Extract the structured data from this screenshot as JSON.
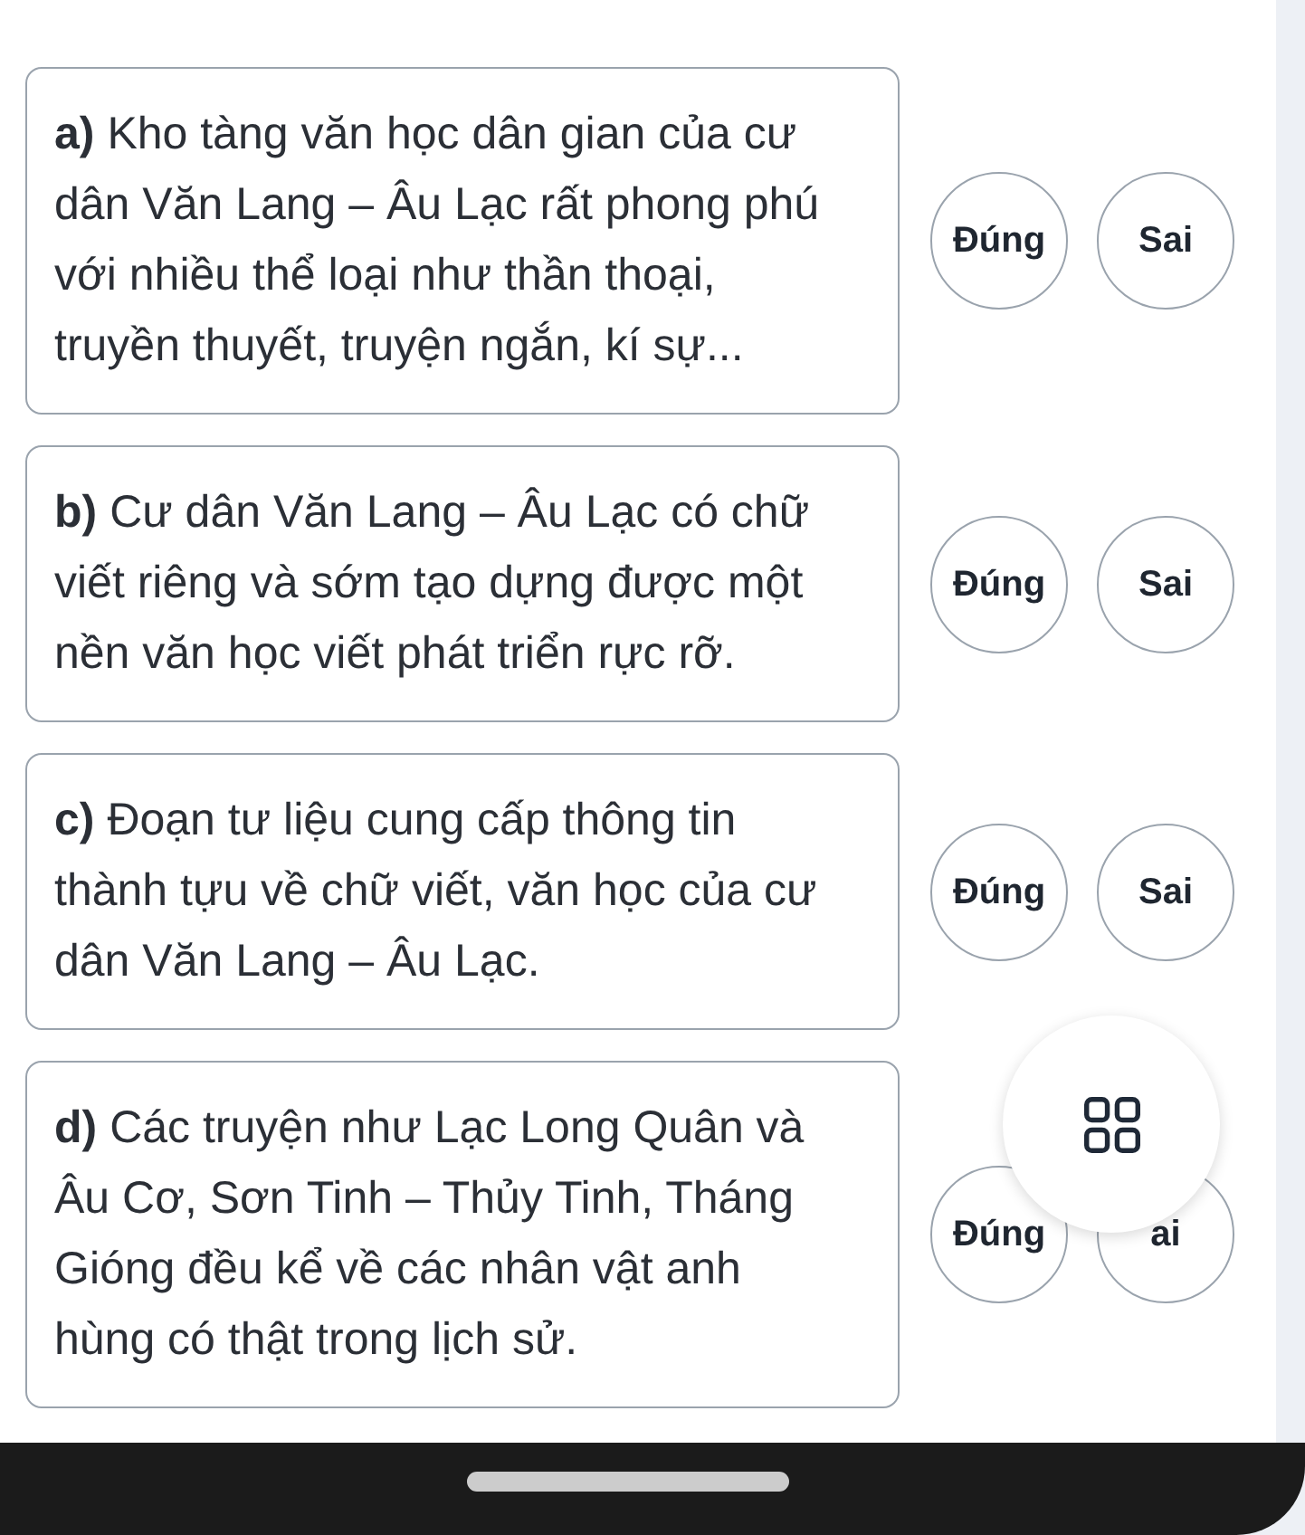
{
  "questions": [
    {
      "label": "a)",
      "text": "Kho tàng văn học dân gian của cư dân Văn Lang – Âu Lạc rất phong phú với nhiều thể loại như thần thoại, truyền thuyết, truyện ngắn, kí sự...",
      "options": [
        {
          "label": "Đúng",
          "selected": false
        },
        {
          "label": "Sai",
          "selected": false
        }
      ]
    },
    {
      "label": "b)",
      "text": "Cư dân Văn Lang – Âu Lạc có chữ viết riêng và sớm tạo dựng được một nền văn học viết phát triển rực rỡ.",
      "options": [
        {
          "label": "Đúng",
          "selected": false
        },
        {
          "label": "Sai",
          "selected": false
        }
      ]
    },
    {
      "label": "c)",
      "text": "Đoạn tư liệu cung cấp thông tin thành tựu về chữ viết, văn học của cư dân Văn Lang – Âu Lạc.",
      "options": [
        {
          "label": "Đúng",
          "selected": false
        },
        {
          "label": "Sai",
          "selected": false
        }
      ]
    },
    {
      "label": "d)",
      "text": "Các truyện như Lạc Long Quân và Âu Cơ, Sơn Tinh – Thủy Tinh, Tháng Gióng đều kể về các nhân vật anh hùng có thật trong lịch sử.",
      "options": [
        {
          "label": "Đúng",
          "selected": false
        },
        {
          "label": "ai",
          "selected": false
        }
      ]
    }
  ]
}
